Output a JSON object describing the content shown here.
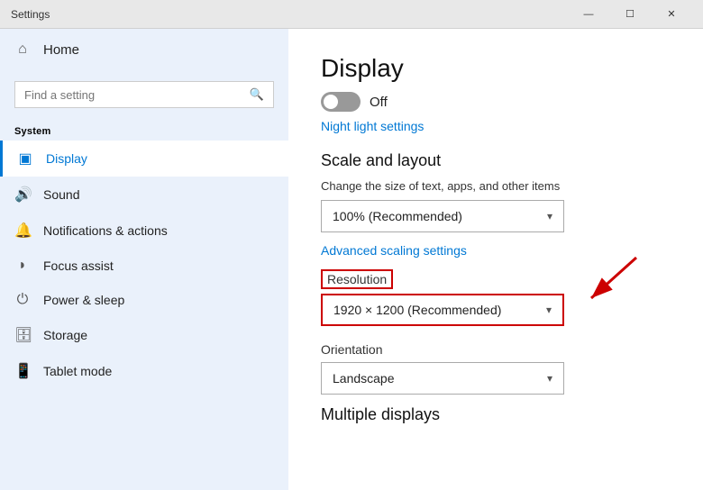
{
  "titlebar": {
    "title": "Settings",
    "minimize": "—",
    "maximize": "☐",
    "close": "✕"
  },
  "sidebar": {
    "home_label": "Home",
    "search_placeholder": "Find a setting",
    "section_label": "System",
    "items": [
      {
        "id": "display",
        "label": "Display",
        "icon": "🖥",
        "active": true
      },
      {
        "id": "sound",
        "label": "Sound",
        "icon": "🔊",
        "active": false
      },
      {
        "id": "notifications",
        "label": "Notifications & actions",
        "icon": "🔔",
        "active": false
      },
      {
        "id": "focus",
        "label": "Focus assist",
        "icon": "🌙",
        "active": false
      },
      {
        "id": "power",
        "label": "Power & sleep",
        "icon": "⏻",
        "active": false
      },
      {
        "id": "storage",
        "label": "Storage",
        "icon": "💾",
        "active": false
      },
      {
        "id": "tablet",
        "label": "Tablet mode",
        "icon": "📱",
        "active": false
      }
    ]
  },
  "content": {
    "title": "Display",
    "toggle_state": "Off",
    "night_link": "Night light settings",
    "scale_section": "Scale and layout",
    "scale_desc": "Change the size of text, apps, and other items",
    "scale_value": "100% (Recommended)",
    "advanced_link": "Advanced scaling settings",
    "resolution_label": "Resolution",
    "resolution_value": "1920 × 1200 (Recommended)",
    "orientation_label": "Orientation",
    "orientation_value": "Landscape",
    "multiple_section": "Multiple displays"
  },
  "colors": {
    "accent": "#0078d4",
    "sidebar_bg": "#eaf1fb",
    "annotation_red": "#cc0000"
  }
}
